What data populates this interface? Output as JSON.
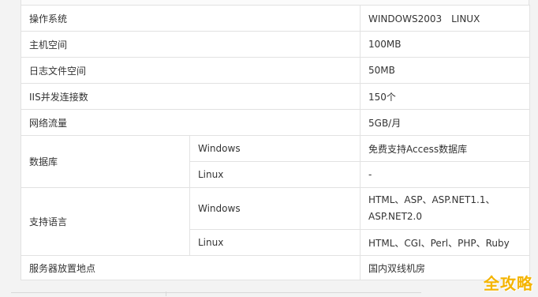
{
  "spec": {
    "os_label": "操作系统",
    "os_value": "WINDOWS2003　LINUX",
    "space_label": "主机空间",
    "space_value": "100MB",
    "log_label": "日志文件空间",
    "log_value": "50MB",
    "iis_label": "IIS并发连接数",
    "iis_value": "150个",
    "traffic_label": "网络流量",
    "traffic_value": "5GB/月",
    "db_label": "数据库",
    "db_windows_label": "Windows",
    "db_windows_value": "免费支持Access数据库",
    "db_linux_label": "Linux",
    "db_linux_value": "-",
    "lang_label": "支持语言",
    "lang_windows_label": "Windows",
    "lang_windows_value": "HTML、ASP、ASP.NET1.1、ASP.NET2.0",
    "lang_linux_label": "Linux",
    "lang_linux_value": "HTML、CGI、Perl、PHP、Ruby",
    "location_label": "服务器放置地点",
    "location_value": "国内双线机房"
  },
  "watermark": "全攻略"
}
